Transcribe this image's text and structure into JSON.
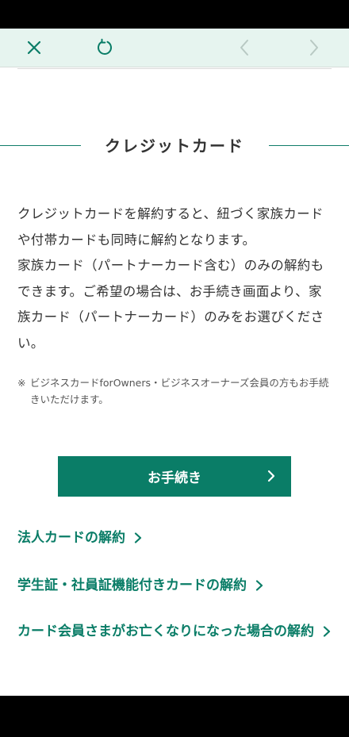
{
  "theme": {
    "accent": "#0a7d67",
    "nav_bg": "#e6f4ef",
    "text": "#333333"
  },
  "nav": {
    "close_icon": "close-icon",
    "reload_icon": "reload-icon",
    "back_icon": "chevron-left-icon",
    "forward_icon": "chevron-right-icon"
  },
  "section": {
    "title": "クレジットカード",
    "body": "クレジットカードを解約すると、紐づく家族カードや付帯カードも同時に解約となります。\n家族カード（パートナーカード含む）のみの解約もできます。ご希望の場合は、お手続き画面より、家族カード（パートナーカード）のみをお選びください。",
    "note_mark": "※",
    "note": "ビジネスカードforOwners・ビジネスオーナーズ会員の方もお手続きいただけます。"
  },
  "procedure_button": {
    "label": "お手続き"
  },
  "links": [
    {
      "label": "法人カードの解約"
    },
    {
      "label": "学生証・社員証機能付きカードの解約"
    },
    {
      "label": "カード会員さまがお亡くなりになった場合の解約"
    }
  ]
}
